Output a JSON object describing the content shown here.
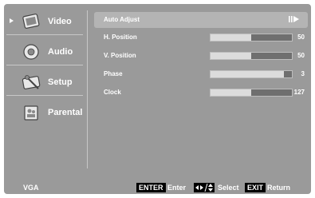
{
  "sidebar": {
    "items": [
      {
        "label": "Video",
        "icon": "video-icon",
        "selected": true
      },
      {
        "label": "Audio",
        "icon": "audio-icon",
        "selected": false
      },
      {
        "label": "Setup",
        "icon": "setup-icon",
        "selected": false
      },
      {
        "label": "Parental",
        "icon": "parental-icon",
        "selected": false
      }
    ]
  },
  "main": {
    "auto_adjust": {
      "label": "Auto Adjust",
      "action_icon": "play-arrow-icon"
    },
    "settings": [
      {
        "label": "H. Position",
        "value": "50",
        "max": 100
      },
      {
        "label": "V. Position",
        "value": "50",
        "max": 100
      },
      {
        "label": "Phase",
        "value": "3",
        "max": 31
      },
      {
        "label": "Clock",
        "value": "127",
        "max": 255
      }
    ]
  },
  "footer": {
    "source": "VGA",
    "enter_key": "ENTER",
    "enter_label": "Enter",
    "select_keys_icon": "arrow-keys-icon",
    "select_label": "Select",
    "exit_key": "EXIT",
    "exit_label": "Return"
  },
  "colors": {
    "panel": "#9a9a9a",
    "selected_row": "#b4b4b4",
    "bar_track": "#dcdcdc",
    "bar_fill": "#6f6f6f",
    "key_bg": "#000000"
  }
}
